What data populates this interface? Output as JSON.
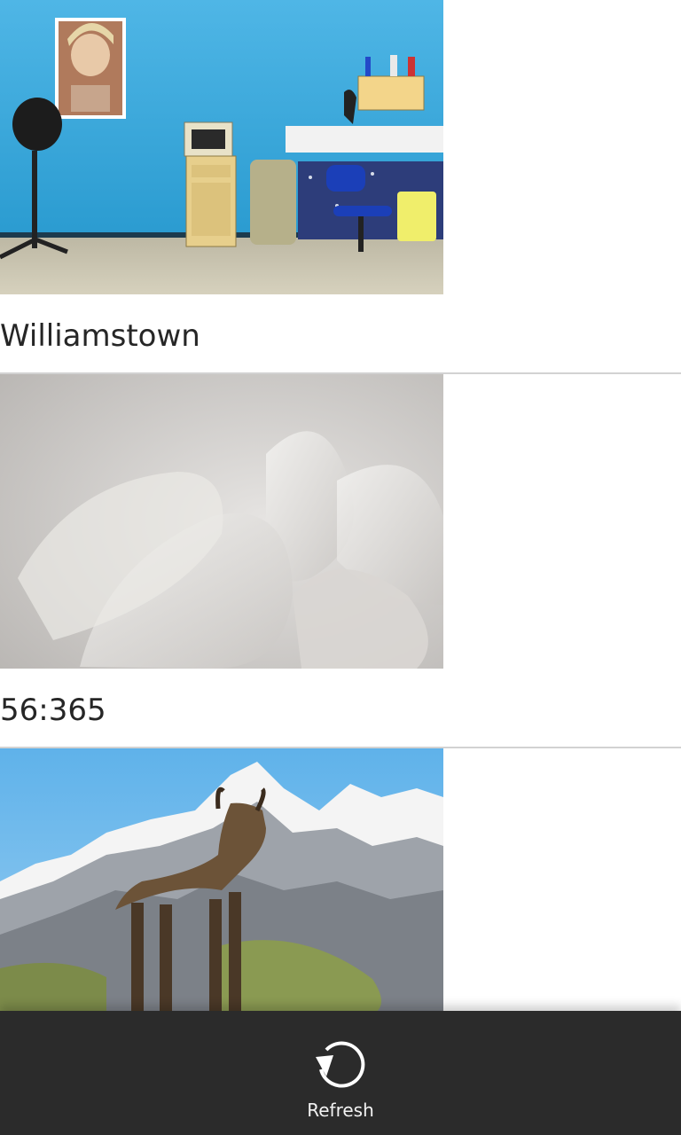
{
  "feed": {
    "items": [
      {
        "caption": "Williamstown",
        "image": "hair-salon-photo"
      },
      {
        "caption": "56:365",
        "image": "white-flower-petals-photo"
      },
      {
        "caption": "",
        "image": "mountain-goat-alps-photo"
      }
    ]
  },
  "action_bar": {
    "refresh_label": "Refresh",
    "refresh_icon": "refresh-icon"
  }
}
